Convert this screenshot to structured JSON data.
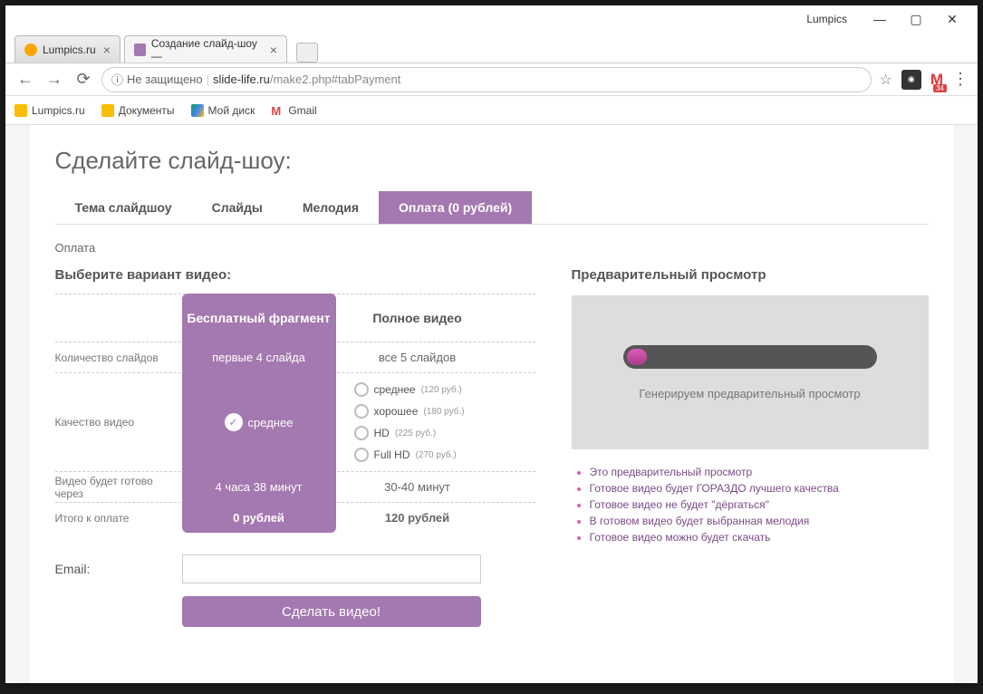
{
  "titlebar": {
    "label": "Lumpics"
  },
  "browser_tabs": {
    "t1": "Lumpics.ru",
    "t2": "Создание слайд-шоу —"
  },
  "addr": {
    "security": "Не защищено",
    "host": "slide-life.ru",
    "path": "/make2.php#tabPayment"
  },
  "gmail_badge": "34",
  "bookmarks": {
    "b1": "Lumpics.ru",
    "b2": "Документы",
    "b3": "Мой диск",
    "b4": "Gmail"
  },
  "page": {
    "title": "Сделайте слайд-шоу:",
    "tabs": {
      "t1": "Тема слайдшоу",
      "t2": "Слайды",
      "t3": "Мелодия",
      "t4": "Оплата (0 рублей)"
    },
    "section": "Оплата",
    "choose": "Выберите вариант видео:",
    "headers": {
      "free": "Бесплатный фрагмент",
      "full": "Полное видео"
    },
    "rows": {
      "slides_label": "Количество слайдов",
      "slides_free": "первые 4 слайда",
      "slides_full": "все 5 слайдов",
      "quality_label": "Качество видео",
      "quality_free": "среднее",
      "ready_label": "Видео будет готово через",
      "ready_free": "4 часа 38 минут",
      "ready_full": "30-40 минут",
      "total_label": "Итого к оплате",
      "total_free": "0 рублей",
      "total_full": "120 рублей"
    },
    "quality_opts": {
      "q1": "среднее",
      "q1p": "(120 руб.)",
      "q2": "хорошее",
      "q2p": "(180 руб.)",
      "q3": "HD",
      "q3p": "(225 руб.)",
      "q4": "Full HD",
      "q4p": "(270 руб.)"
    },
    "email_label": "Email:",
    "make_button": "Сделать видео!",
    "preview_title": "Предварительный просмотр",
    "preview_status": "Генерируем предварительный просмотр",
    "notes": {
      "n1": "Это предварительный просмотр",
      "n2": "Готовое видео будет ГОРАЗДО лучшего качества",
      "n3": "Готовое видео не будет \"дёргаться\"",
      "n4": "В готовом видео будет выбранная мелодия",
      "n5": "Готовое видео можно будет скачать"
    }
  }
}
